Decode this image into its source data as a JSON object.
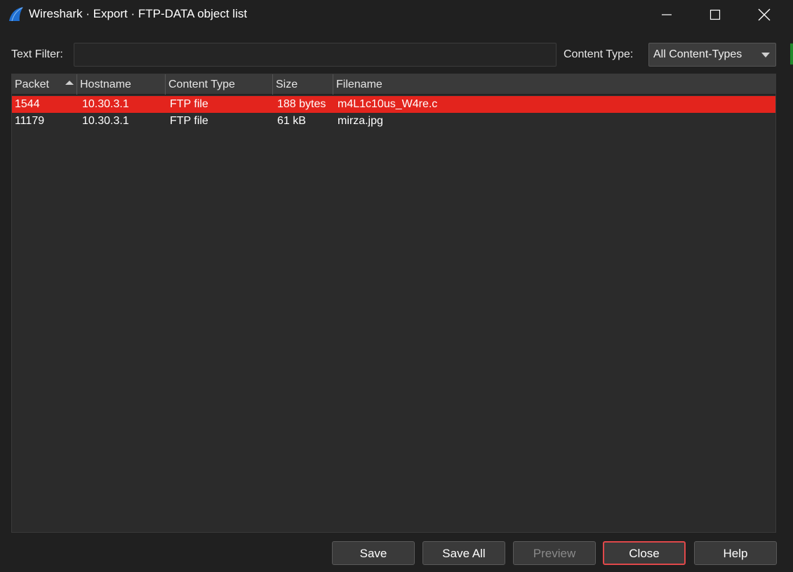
{
  "window": {
    "title": "Wireshark · Export · FTP-DATA object list"
  },
  "filter": {
    "text_label": "Text Filter:",
    "text_value": "",
    "content_type_label": "Content Type:",
    "content_type_value": "All Content-Types"
  },
  "table": {
    "columns": [
      "Packet",
      "Hostname",
      "Content Type",
      "Size",
      "Filename"
    ],
    "sorted_column": "Packet",
    "rows": [
      {
        "packet": "1544",
        "hostname": "10.30.3.1",
        "content_type": "FTP file",
        "size": "188 bytes",
        "filename": "m4L1c10us_W4re.c",
        "selected": true
      },
      {
        "packet": "11179",
        "hostname": "10.30.3.1",
        "content_type": "FTP file",
        "size": "61 kB",
        "filename": "mirza.jpg",
        "selected": false
      }
    ]
  },
  "buttons": {
    "save": "Save",
    "save_all": "Save All",
    "preview": "Preview",
    "close": "Close",
    "help": "Help"
  },
  "colors": {
    "selection": "#e3241d",
    "background": "#202020",
    "focus_border": "#e0484a"
  },
  "icons": {
    "app": "wireshark-fin-icon",
    "minimize": "minimize-icon",
    "maximize": "maximize-icon",
    "close": "close-icon",
    "dropdown": "chevron-down-icon",
    "sort": "sort-ascending-icon"
  }
}
